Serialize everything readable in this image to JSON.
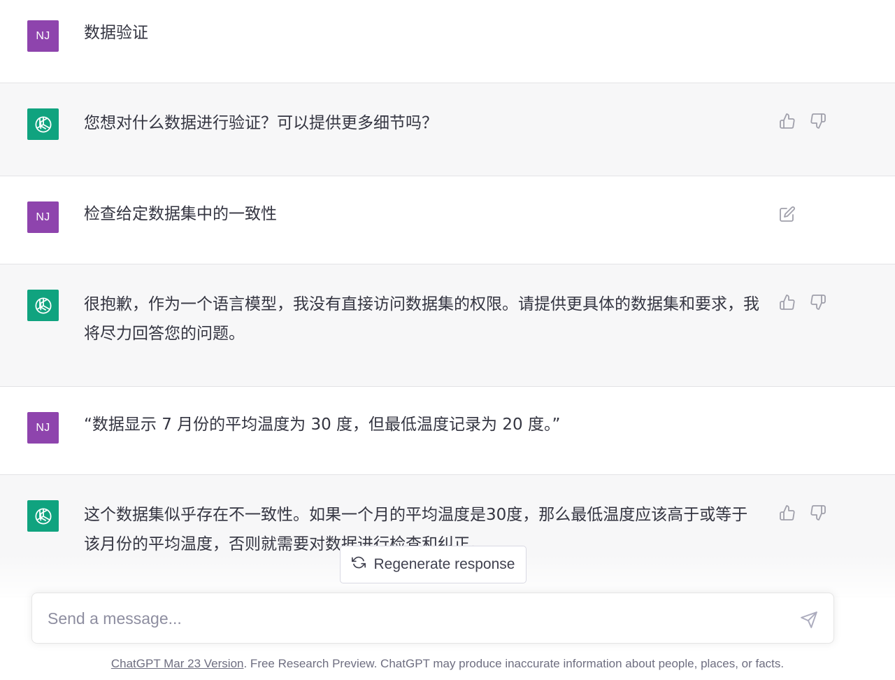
{
  "messages": [
    {
      "role": "user",
      "avatar": "NJ",
      "text": "数据验证"
    },
    {
      "role": "assistant",
      "text": "您想对什么数据进行验证？可以提供更多细节吗？"
    },
    {
      "role": "user",
      "avatar": "NJ",
      "text": "检查给定数据集中的一致性"
    },
    {
      "role": "assistant",
      "text": "很抱歉，作为一个语言模型，我没有直接访问数据集的权限。请提供更具体的数据集和要求，我将尽力回答您的问题。"
    },
    {
      "role": "user",
      "avatar": "NJ",
      "text": "“数据显示 7 月份的平均温度为 30 度，但最低温度记录为 20 度。”"
    },
    {
      "role": "assistant",
      "text": "这个数据集似乎存在不一致性。如果一个月的平均温度是30度，那么最低温度应该高于或等于该月份的平均温度，否则就需要对数据进行检查和纠正。"
    }
  ],
  "regenerate_label": "Regenerate response",
  "composer": {
    "placeholder": "Send a message..."
  },
  "footer": {
    "link_text": "ChatGPT Mar 23 Version",
    "rest_text": ". Free Research Preview. ChatGPT may produce inaccurate information about people, places, or facts."
  },
  "icons": {
    "user_avatar_color": "#8e44ad",
    "bot_avatar_color": "#10a37f",
    "bot_avatar": "openai-logo-icon",
    "like": "thumbs-up-icon",
    "dislike": "thumbs-down-icon",
    "edit": "edit-icon",
    "send": "send-icon",
    "regenerate": "refresh-icon"
  }
}
